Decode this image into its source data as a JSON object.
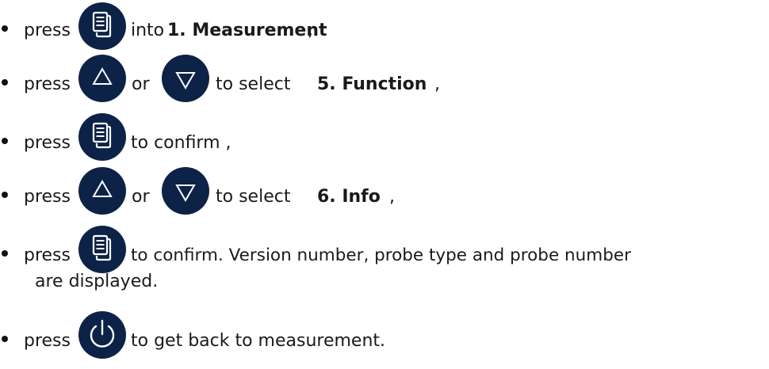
{
  "steps": [
    {
      "press": "press",
      "after": "into",
      "bold": "1. Measurement",
      "tail": ",",
      "icon": "menu-button-icon"
    },
    {
      "press": "press",
      "or": "or",
      "after": "to select",
      "bold": "5. Function",
      "tail": ",",
      "icons": [
        "up-arrow-button-icon",
        "down-arrow-button-icon"
      ]
    },
    {
      "press": "press",
      "after": "to confirm ,",
      "icon": "menu-button-icon"
    },
    {
      "press": "press",
      "or": "or",
      "after": "to select",
      "bold": "6. Info",
      "tail": ",",
      "icons": [
        "up-arrow-button-icon",
        "down-arrow-button-icon"
      ]
    },
    {
      "press": "press",
      "after": "to confirm. Version number, probe type and probe number",
      "line2": "are displayed.",
      "icon": "menu-button-icon"
    },
    {
      "press": "press",
      "after": "to get back to measurement.",
      "icon": "power-button-icon"
    }
  ],
  "colors": {
    "button_fill": "#0d2247",
    "icon_stroke": "#ffffff",
    "text": "#1a1a1a"
  }
}
